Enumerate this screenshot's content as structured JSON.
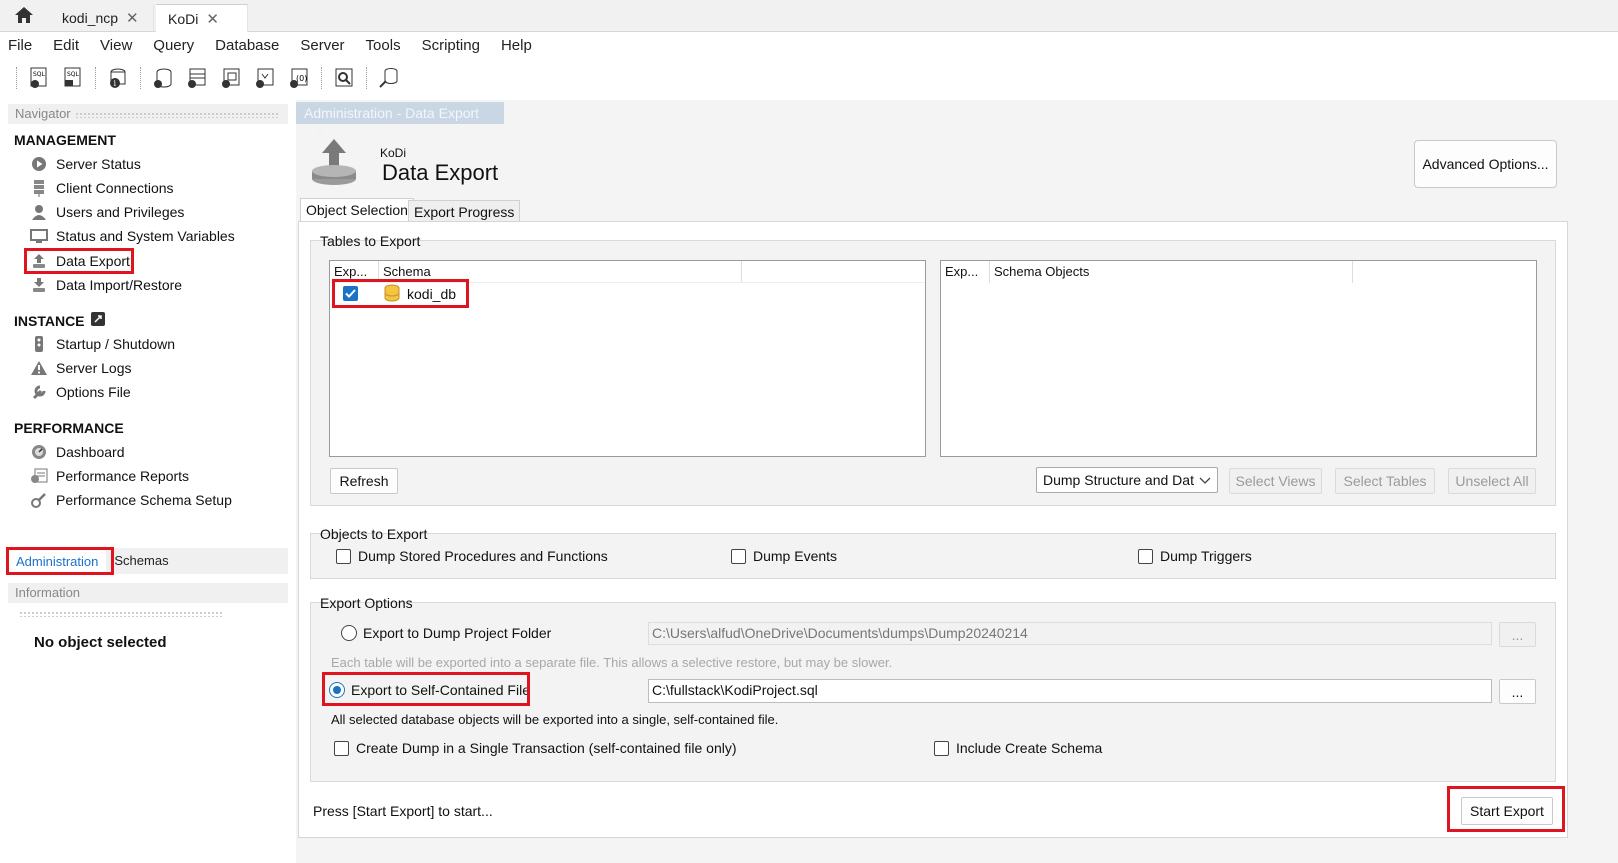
{
  "tabs": [
    {
      "label": "kodi_ncp"
    },
    {
      "label": "KoDi"
    }
  ],
  "menu": [
    "File",
    "Edit",
    "View",
    "Query",
    "Database",
    "Server",
    "Tools",
    "Scripting",
    "Help"
  ],
  "navigator": {
    "header": "Navigator",
    "management_title": "MANAGEMENT",
    "management": [
      "Server Status",
      "Client Connections",
      "Users and Privileges",
      "Status and System Variables",
      "Data Export",
      "Data Import/Restore"
    ],
    "instance_title": "INSTANCE",
    "instance": [
      "Startup / Shutdown",
      "Server Logs",
      "Options File"
    ],
    "performance_title": "PERFORMANCE",
    "performance": [
      "Dashboard",
      "Performance Reports",
      "Performance Schema Setup"
    ],
    "tabs": [
      "Administration",
      "Schemas"
    ],
    "info_header": "Information",
    "info_text": "No object selected"
  },
  "main": {
    "tab_label": "Administration - Data Export",
    "connection": "KoDi",
    "title": "Data Export",
    "advanced_button": "Advanced Options...",
    "subtabs": [
      "Object Selection",
      "Export Progress"
    ],
    "tables_group": "Tables to Export",
    "left_table": {
      "col_export": "Exp...",
      "col_schema": "Schema",
      "rows": [
        {
          "checked": true,
          "name": "kodi_db"
        }
      ]
    },
    "right_table": {
      "col_export": "Exp...",
      "col_objects": "Schema Objects"
    },
    "refresh": "Refresh",
    "dump_select": "Dump Structure and Dat",
    "select_views": "Select Views",
    "select_tables": "Select Tables",
    "unselect_all": "Unselect All",
    "objects_group": "Objects to Export",
    "dump_procs": "Dump Stored Procedures and Functions",
    "dump_events": "Dump Events",
    "dump_triggers": "Dump Triggers",
    "options_group": "Export Options",
    "opt_folder": "Export to Dump Project Folder",
    "folder_path": "C:\\Users\\alfud\\OneDrive\\Documents\\dumps\\Dump20240214",
    "folder_hint": "Each table will be exported into a separate file. This allows a selective restore, but may be slower.",
    "opt_file": "Export to Self-Contained File",
    "file_path": "C:\\fullstack\\KodiProject.sql",
    "file_hint": "All selected database objects will be exported into a single, self-contained file.",
    "single_tx": "Create Dump in a Single Transaction (self-contained file only)",
    "include_schema": "Include Create Schema",
    "browse": "...",
    "status": "Press [Start Export] to start...",
    "start_export": "Start Export"
  },
  "colors": {
    "highlight": "#e0141e",
    "accent": "#1a73c8"
  }
}
